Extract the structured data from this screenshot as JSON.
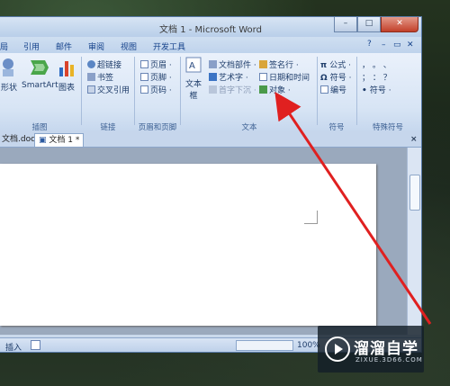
{
  "window": {
    "title": "文档 1 - Microsoft Word",
    "controls": [
      "–",
      "□",
      "✕"
    ]
  },
  "ribbon_tabs": {
    "left_partial": "局",
    "references": "引用",
    "mailings": "邮件",
    "review": "审阅",
    "view": "视图",
    "developer": "开发工具",
    "right_controls": [
      "?",
      "–",
      "▭",
      "✕"
    ]
  },
  "groups": {
    "illustrations": {
      "label": "插图",
      "shapes": "形状",
      "smartart": "SmartArt",
      "chart": "图表"
    },
    "links": {
      "label": "链接",
      "hyperlink": "超链接",
      "bookmark": "书签",
      "crossref": "交叉引用"
    },
    "header_footer": {
      "label": "页眉和页脚",
      "header": "页眉 ·",
      "footer": "页脚 ·",
      "page_number": "页码 ·"
    },
    "text": {
      "label": "文本",
      "textbox": "文本框",
      "quickparts": "文档部件 ·",
      "wordart": "艺术字 ·",
      "dropcap": "首字下沉 ·",
      "signature": "签名行 ·",
      "datetime": "日期和时间",
      "object": "对象 ·"
    },
    "symbols": {
      "label": "符号",
      "equation": "公式 ·",
      "symbol": "符号 ·",
      "number": "编号"
    },
    "special": {
      "label": "特殊符号",
      "row1": "，  。  、",
      "row2": "；  ：  ？",
      "symbol": "符号 ·"
    }
  },
  "doc_tabs": {
    "tab1": "文档.docx",
    "tab2": "文档 1 *",
    "close": "×"
  },
  "status": {
    "insert": "插入",
    "zoom": "100%"
  },
  "watermark": {
    "title": "溜溜自学",
    "subtitle": "ZIXUE.3D66.COM"
  },
  "colors": {
    "ribbon": "#d8e5f5",
    "arrow": "#e02020",
    "accent": "#15428b"
  }
}
